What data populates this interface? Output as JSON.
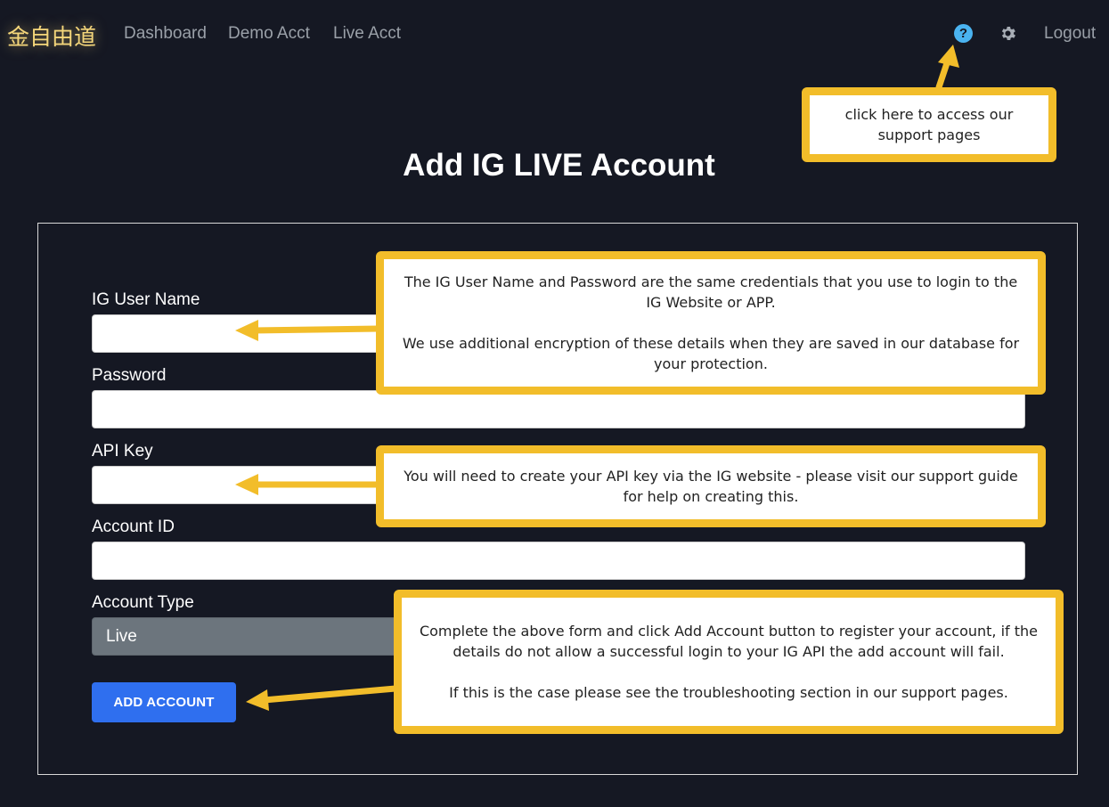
{
  "nav": {
    "brand": "金自由道",
    "links": [
      "Dashboard",
      "Demo Acct",
      "Live Acct"
    ],
    "help_icon": "help-icon",
    "settings_icon": "gear-icon",
    "logout": "Logout"
  },
  "page": {
    "title": "Add IG LIVE Account"
  },
  "form": {
    "username_label": "IG User Name",
    "password_label": "Password",
    "api_key_label": "API Key",
    "account_id_label": "Account ID",
    "account_type_label": "Account Type",
    "account_type_value": "Live",
    "submit_label": "ADD ACCOUNT"
  },
  "callouts": {
    "support": "click here to access our support pages",
    "credentials_1": "The IG User Name and Password are the same credentials that you use to login to the IG Website or APP.",
    "credentials_2": "We use additional encryption of these details when they are saved in our database for your protection.",
    "api_key": "You will need to create your API key via the IG website - please visit our support guide for help on creating this.",
    "submit_1": "Complete the above form and click Add Account button to register your account, if the details do not allow a successful login to your IG API the add account will fail.",
    "submit_2": "If this is the case please see the troubleshooting section in our support pages."
  },
  "colors": {
    "background": "#151823",
    "callout_border": "#f2bd2a",
    "primary_button": "#2f6fef",
    "help_icon": "#4ab3f0"
  }
}
